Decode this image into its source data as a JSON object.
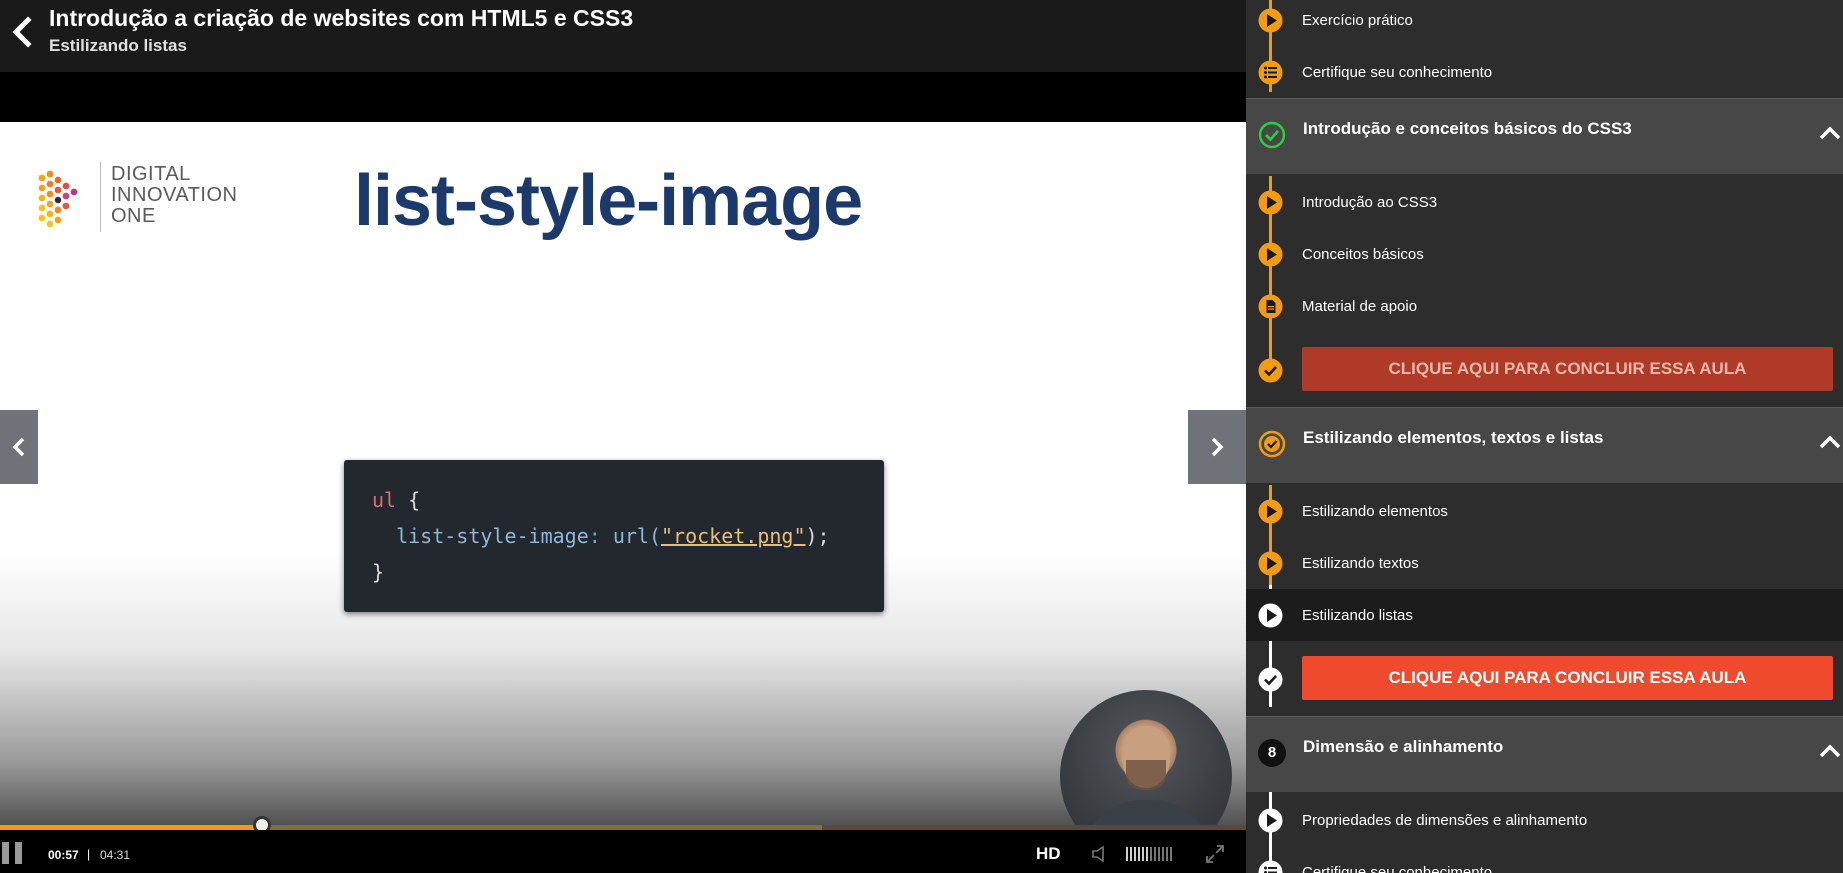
{
  "header": {
    "course_title": "Introdução a criação de websites com HTML5 e CSS3",
    "lesson_title": "Estilizando listas"
  },
  "slide": {
    "logo_lines": [
      "DIGITAL",
      "INNOVATION",
      "ONE"
    ],
    "title": "list-style-image",
    "code": {
      "selector": "ul",
      "open_brace": " {",
      "property": "list-style-image",
      "colon": ": ",
      "function": "url(",
      "string": "\"rocket.png\"",
      "close_call": ");",
      "close_brace": "}"
    }
  },
  "player": {
    "current_time": "00:57",
    "separator": "|",
    "total_time": "04:31",
    "progress": 0.21,
    "buffered": 0.66,
    "quality_label": "HD"
  },
  "sidebar": {
    "top_items": [
      {
        "label": "Exercício prático",
        "icon": "play-icon"
      },
      {
        "label": "Certifique seu conhecimento",
        "icon": "list-icon"
      }
    ],
    "modules": [
      {
        "title": "Introdução e conceitos básicos do CSS3",
        "status_icon": "check-circle-icon",
        "items": [
          {
            "label": "Introdução ao CSS3",
            "icon": "play-icon"
          },
          {
            "label": "Conceitos básicos",
            "icon": "play-icon"
          },
          {
            "label": "Material de apoio",
            "icon": "document-icon"
          }
        ],
        "conclude_label": "CLIQUE AQUI PARA CONCLUIR ESSA AULA"
      },
      {
        "title": "Estilizando elementos, textos e listas",
        "status_icon": "progress-circle-icon",
        "items": [
          {
            "label": "Estilizando elementos",
            "icon": "play-icon"
          },
          {
            "label": "Estilizando textos",
            "icon": "play-icon"
          },
          {
            "label": "Estilizando listas",
            "icon": "play-icon",
            "active": true
          }
        ],
        "conclude_label": "CLIQUE AQUI PARA CONCLUIR ESSA AULA"
      },
      {
        "title": "Dimensão e alinhamento",
        "number": "8",
        "items": [
          {
            "label": "Propriedades de dimensões e alinhamento",
            "icon": "play-icon"
          },
          {
            "label": "Certifique seu conhecimento",
            "icon": "list-icon"
          }
        ]
      }
    ]
  },
  "colors": {
    "accent": "#f39c12",
    "conclude_done": "#b03a28",
    "conclude_todo": "#f04a2e",
    "module_bg": "#474747",
    "sidebar_bg": "#2d2d2d",
    "slide_title": "#1b3a6b"
  }
}
